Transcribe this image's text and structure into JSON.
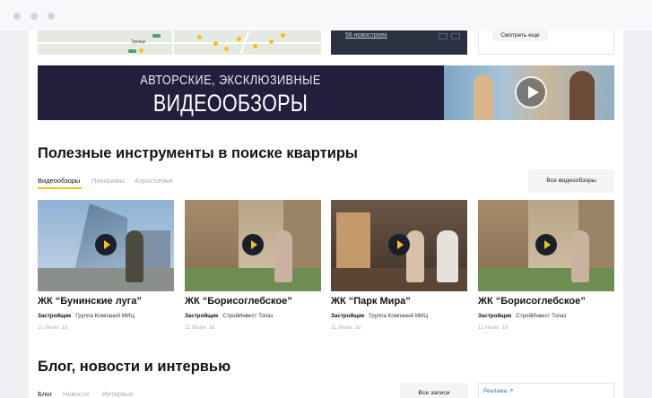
{
  "top": {
    "map_city": "Троицк",
    "news_link": "56 новостроек",
    "more_button": "Смотреть еще"
  },
  "banner": {
    "line1": "АВТОРСКИЕ, ЭКСКЛЮЗИВНЫЕ",
    "line2": "ВИДЕООБЗОРЫ"
  },
  "tools": {
    "heading": "Полезные инструменты в поиске квартиры",
    "tabs": [
      "Видеообзоры",
      "Панорамы",
      "Аэросъемки"
    ],
    "all_button": "Все видеообзоры",
    "cards": [
      {
        "title": "ЖК “Бунинские луга”",
        "developer_label": "Застройщик",
        "developer": "Группа Компаний МИЦ",
        "date": "11 Июня, 18"
      },
      {
        "title": "ЖК “Борисоглебское”",
        "developer_label": "Застройщик",
        "developer": "СтройИнвест Топаз",
        "date": "11 Июня, 18"
      },
      {
        "title": "ЖК “Парк Мира”",
        "developer_label": "Застройщик",
        "developer": "Группа Компаний МИЦ",
        "date": "11 Июня, 18"
      },
      {
        "title": "ЖК “Борисоглебское”",
        "developer_label": "Застройщик",
        "developer": "СтройИнвест Топаз",
        "date": "11 Июня, 18"
      }
    ]
  },
  "blog": {
    "heading": "Блог, новости и интервью",
    "tabs": [
      "Блог",
      "Новости",
      "Интервью"
    ],
    "all_button": "Все записи",
    "ad_label": "Реклама ↗"
  },
  "colors": {
    "accent": "#f2c21b",
    "banner_bg": "#241e3d",
    "link": "#3f6fcf"
  }
}
